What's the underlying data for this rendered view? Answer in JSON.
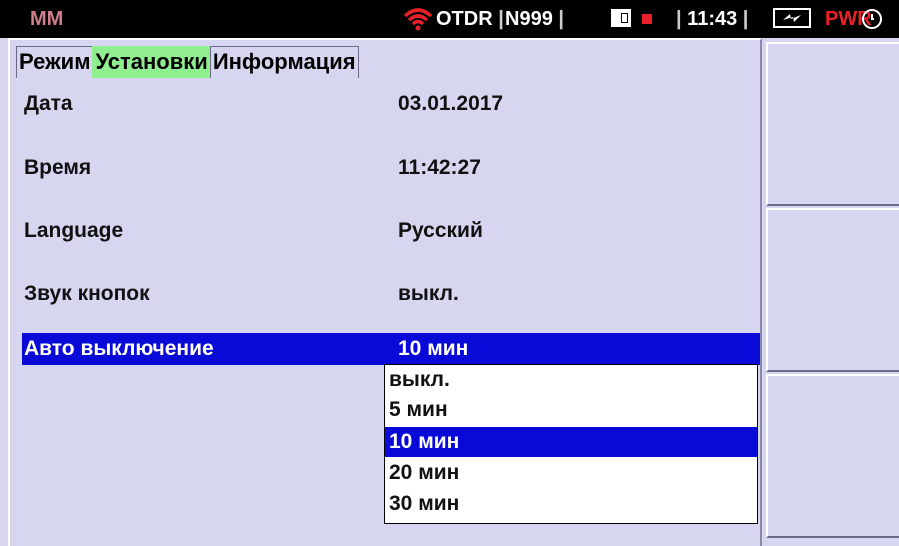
{
  "status_bar": {
    "mode": "MM",
    "wifi_icon": "wifi-icon",
    "app": "OTDR",
    "device": "N999",
    "separator": "|",
    "sd_icon": "sd-card-icon",
    "recording_icon": "record-indicator-icon",
    "time": "11:43",
    "battery_icon": "battery-charging-icon",
    "power": "PWR",
    "clock_icon": "clock-icon"
  },
  "tabs": [
    {
      "label": "Режим",
      "active": false
    },
    {
      "label": "Установки",
      "active": true
    },
    {
      "label": "Информация",
      "active": false
    }
  ],
  "settings": [
    {
      "label": "Дата",
      "value": "03.01.2017"
    },
    {
      "label": "Время",
      "value": "11:42:27"
    },
    {
      "label": "Language",
      "value": "Русский"
    },
    {
      "label": "Звук кнопок",
      "value": "выкл."
    },
    {
      "label": "Авто выключение",
      "value": "10 мин",
      "selected": true
    }
  ],
  "dropdown": {
    "options": [
      "выкл.",
      "5 мин",
      "10 мин",
      "20 мин",
      "30 мин"
    ],
    "selected": "10 мин"
  },
  "softkeys": [
    "",
    "",
    ""
  ],
  "colors": {
    "background": "#d6d6f0",
    "selection": "#0a0ad8",
    "active_tab": "#90ee90",
    "mode_text": "#d27d8c",
    "pwr_text": "#e8202a"
  }
}
